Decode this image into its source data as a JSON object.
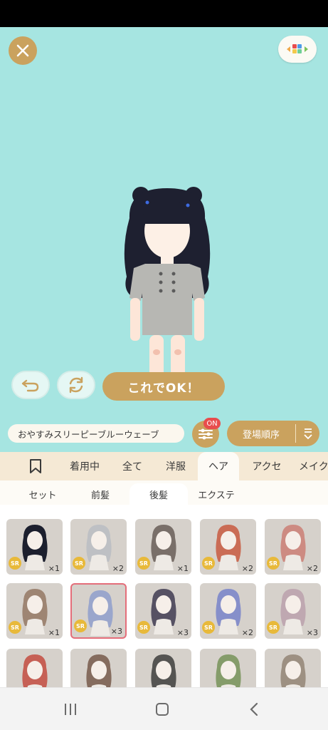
{
  "ok_button_label": "これでOK！",
  "set_name": "おやすみスリーピーブルーウェーブ",
  "filter_badge": "ON",
  "sort_label": "登場順序",
  "tabs": [
    {
      "label": "着用中"
    },
    {
      "label": "全て"
    },
    {
      "label": "洋服"
    },
    {
      "label": "ヘア"
    },
    {
      "label": "アクセ"
    },
    {
      "label": "メイク"
    }
  ],
  "subtabs": [
    {
      "label": "セット"
    },
    {
      "label": "前髪"
    },
    {
      "label": "後髪"
    },
    {
      "label": "エクステ"
    }
  ],
  "items": [
    {
      "rarity": "SR",
      "count": "×1",
      "hair_color": "#1c1f2e"
    },
    {
      "rarity": "SR",
      "count": "×2",
      "hair_color": "#b5b9c2"
    },
    {
      "rarity": "SR",
      "count": "×1",
      "hair_color": "#5a4e48"
    },
    {
      "rarity": "SR",
      "count": "×2",
      "hair_color": "#c64a2e"
    },
    {
      "rarity": "SR",
      "count": "×2",
      "hair_color": "#c9736a"
    },
    {
      "rarity": "SR",
      "count": "×1",
      "hair_color": "#8b6b55"
    },
    {
      "rarity": "SR",
      "count": "×3",
      "hair_color": "#9aa6cc"
    },
    {
      "rarity": "SR",
      "count": "×3",
      "hair_color": "#2b2540"
    },
    {
      "rarity": "SR",
      "count": "×2",
      "hair_color": "#6b78c9"
    },
    {
      "rarity": "SR",
      "count": "×3",
      "hair_color": "#b79aa8"
    },
    {
      "rarity": "",
      "count": "",
      "hair_color": "#c03a2e"
    },
    {
      "rarity": "",
      "count": "",
      "hair_color": "#6a4a3a"
    },
    {
      "rarity": "",
      "count": "",
      "hair_color": "#2a2a2a"
    },
    {
      "rarity": "",
      "count": "",
      "hair_color": "#6a8a4a"
    },
    {
      "rarity": "",
      "count": "",
      "hair_color": "#8a7a6a"
    }
  ],
  "colors": {
    "stage_bg": "#a6e5e1",
    "gold": "#caa25e",
    "tab_bg": "#f5e9d5",
    "selected_border": "#e46e7a"
  }
}
